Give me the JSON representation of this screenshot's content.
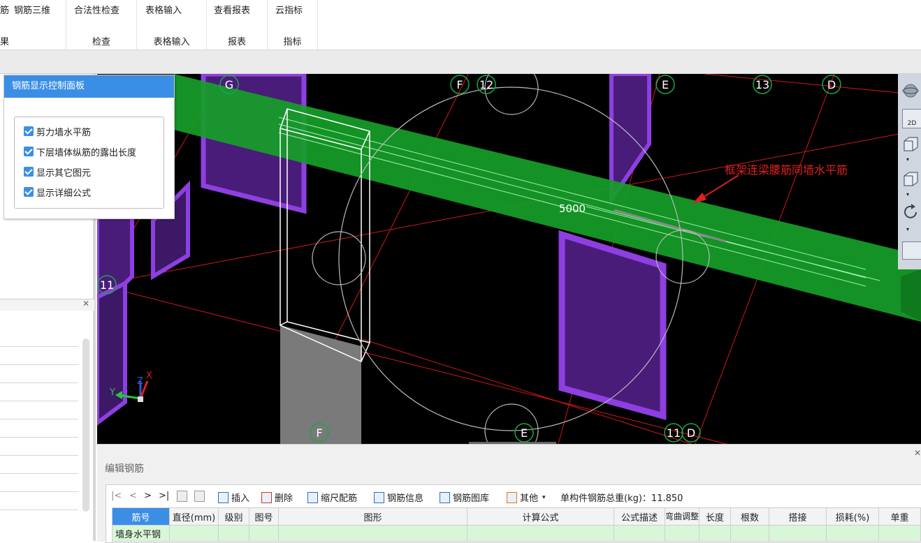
{
  "ribbon": {
    "buttons": [
      "筋",
      "钢筋三维",
      "合法性检查",
      "表格输入",
      "查看报表",
      "云指标"
    ],
    "groups": [
      "果",
      "检查",
      "表格输入",
      "报表",
      "指标"
    ]
  },
  "control_panel": {
    "title": "钢筋显示控制面板",
    "options": [
      {
        "label": "剪力墙水平筋",
        "checked": true
      },
      {
        "label": "下层墙体纵筋的露出长度",
        "checked": true
      },
      {
        "label": "显示其它图元",
        "checked": true
      },
      {
        "label": "显示详细公式",
        "checked": true
      }
    ]
  },
  "viewport": {
    "axis_labels": [
      "G",
      "F",
      "12",
      "E",
      "13",
      "D",
      "11",
      "F",
      "E",
      "11",
      "D"
    ],
    "dimension_label": "5000",
    "annotation": "框架连梁腰筋同墙水平筋",
    "gizmo": {
      "x": "X",
      "y": "Y",
      "z": "Z"
    },
    "side_tool_2d": "2D"
  },
  "editor": {
    "title": "编辑钢筋",
    "nav": [
      "|<",
      "<",
      ">",
      ">|"
    ],
    "toolbar": {
      "insert": "插入",
      "delete": "删除",
      "scale": "缩尺配筋",
      "info": "钢筋信息",
      "library": "钢筋图库",
      "other": "其他",
      "total_label": "单构件钢筋总重(kg)：11.850"
    },
    "columns": [
      "筋号",
      "直径(mm)",
      "级别",
      "图号",
      "图形",
      "计算公式",
      "公式描述",
      "弯曲调整",
      "长度",
      "根数",
      "搭接",
      "损耗(%)",
      "单重"
    ],
    "rows": [
      [
        "墙身水平钢",
        "",
        "",
        "",
        "",
        "",
        "",
        "",
        "",
        "",
        "",
        "",
        ""
      ]
    ]
  },
  "colors": {
    "accent": "#3b8ee6",
    "beam": "#16a02a",
    "wall": "#7b2fc4",
    "annotation": "#e02020"
  }
}
